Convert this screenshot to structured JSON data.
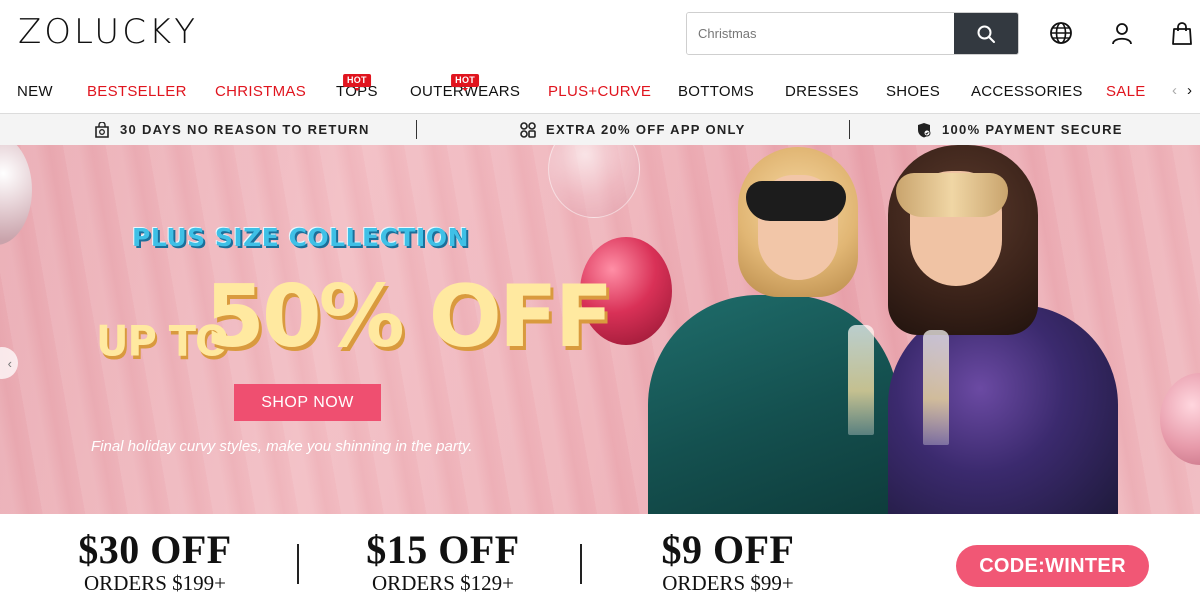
{
  "header": {
    "logo": "ZOLUCKY",
    "search": {
      "placeholder": "Christmas"
    },
    "icons": [
      "globe-icon",
      "user-icon",
      "bag-icon"
    ]
  },
  "nav": {
    "items": [
      {
        "label": "NEW",
        "red": false,
        "hot": false
      },
      {
        "label": "BESTSELLER",
        "red": true,
        "hot": false
      },
      {
        "label": "CHRISTMAS",
        "red": true,
        "hot": false
      },
      {
        "label": "TOPS",
        "red": false,
        "hot": true
      },
      {
        "label": "OUTERWEARS",
        "red": false,
        "hot": true
      },
      {
        "label": "PLUS+CURVE",
        "red": true,
        "hot": false
      },
      {
        "label": "BOTTOMS",
        "red": false,
        "hot": false
      },
      {
        "label": "DRESSES",
        "red": false,
        "hot": false
      },
      {
        "label": "SHOES",
        "red": false,
        "hot": false
      },
      {
        "label": "ACCESSORIES",
        "red": false,
        "hot": false
      },
      {
        "label": "SALE",
        "red": true,
        "hot": false
      }
    ],
    "hot_label": "HOT",
    "prev_arrow": "‹",
    "next_arrow": "›"
  },
  "promo_strip": [
    {
      "icon": "return-bag-icon",
      "text": "30 DAYS NO REASON TO RETURN"
    },
    {
      "icon": "app-icon",
      "text": "EXTRA 20% OFF APP ONLY"
    },
    {
      "icon": "shield-icon",
      "text": "100% PAYMENT SECURE"
    }
  ],
  "banner": {
    "subtitle": "PLUS SIZE COLLECTION",
    "up_to": "UP TO",
    "discount": "50% OFF",
    "cta": "SHOP NOW",
    "tagline": "Final holiday curvy styles, make you shinning in the party.",
    "prev_arrow": "‹"
  },
  "coupons": [
    {
      "amount": "$30 OFF",
      "min": "ORDERS $199+"
    },
    {
      "amount": "$15 OFF",
      "min": "ORDERS $129+"
    },
    {
      "amount": "$9 OFF",
      "min": "ORDERS $99+"
    }
  ],
  "code": "CODE:WINTER",
  "colors": {
    "accent_red": "#e0141e",
    "cta_pink": "#ef4f70",
    "search_button": "#333940",
    "strip_bg": "#f4f4f4"
  }
}
